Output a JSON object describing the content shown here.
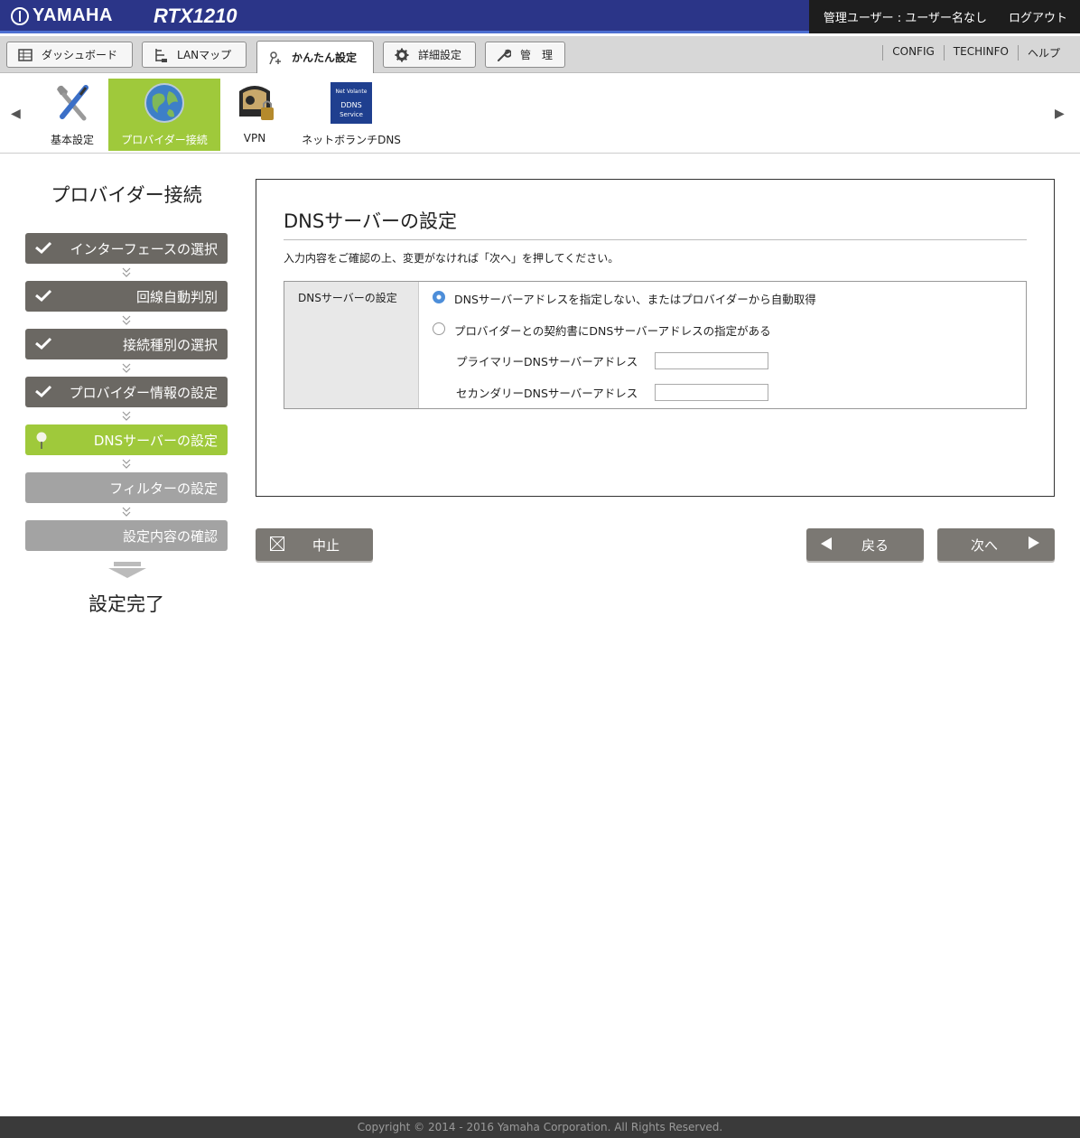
{
  "header": {
    "brand": "YAMAHA",
    "model": "RTX1210",
    "user": "管理ユーザー : ユーザー名なし",
    "logout": "ログアウト"
  },
  "tabs": [
    {
      "label": "ダッシュボード",
      "icon": "dashboard-icon"
    },
    {
      "label": "LANマップ",
      "icon": "lan-map-icon"
    },
    {
      "label": "かんたん設定",
      "icon": "wizard-icon"
    },
    {
      "label": "詳細設定",
      "icon": "gear-icon"
    },
    {
      "label": "管　理",
      "icon": "wrench-icon"
    }
  ],
  "toplinks": [
    "CONFIG",
    "TECHINFO",
    "ヘルプ"
  ],
  "iconmenu": [
    {
      "label": "基本設定",
      "icon": "tools-icon"
    },
    {
      "label": "プロバイダー接続",
      "icon": "globe-icon"
    },
    {
      "label": "VPN",
      "icon": "vpn-lock-icon"
    },
    {
      "label": "ネットボランチDNS",
      "icon": "ddns-service-icon",
      "badge_line1": "Net Volante",
      "badge_line2": "DDNS",
      "badge_line3": "Service"
    }
  ],
  "sidebar": {
    "title": "プロバイダー接続",
    "steps": [
      {
        "label": "インターフェースの選択",
        "state": "done"
      },
      {
        "label": "回線自動判別",
        "state": "done"
      },
      {
        "label": "接続種別の選択",
        "state": "done"
      },
      {
        "label": "プロバイダー情報の設定",
        "state": "done"
      },
      {
        "label": "DNSサーバーの設定",
        "state": "current"
      },
      {
        "label": "フィルターの設定",
        "state": "todo"
      },
      {
        "label": "設定内容の確認",
        "state": "todo"
      }
    ],
    "final": "設定完了"
  },
  "main": {
    "title": "DNSサーバーの設定",
    "instruction": "入力内容をご確認の上、変更がなければ「次へ」を押してください。",
    "field_label": "DNSサーバーの設定",
    "option_auto": "DNSサーバーアドレスを指定しない、またはプロバイダーから自動取得",
    "option_manual": "プロバイダーとの契約書にDNSサーバーアドレスの指定がある",
    "primary_label": "プライマリーDNSサーバーアドレス",
    "primary_value": "",
    "secondary_label": "セカンダリーDNSサーバーアドレス",
    "secondary_value": "",
    "selected_option": "auto"
  },
  "buttons": {
    "cancel": "中止",
    "back": "戻る",
    "next": "次へ"
  },
  "footer": "Copyright © 2014 - 2016 Yamaha Corporation. All Rights Reserved.",
  "colors": {
    "header_bg": "#2b3588",
    "accent_green": "#9fc93b",
    "step_done": "#6b6863",
    "step_todo": "#a3a3a3",
    "button": "#7b7873"
  }
}
